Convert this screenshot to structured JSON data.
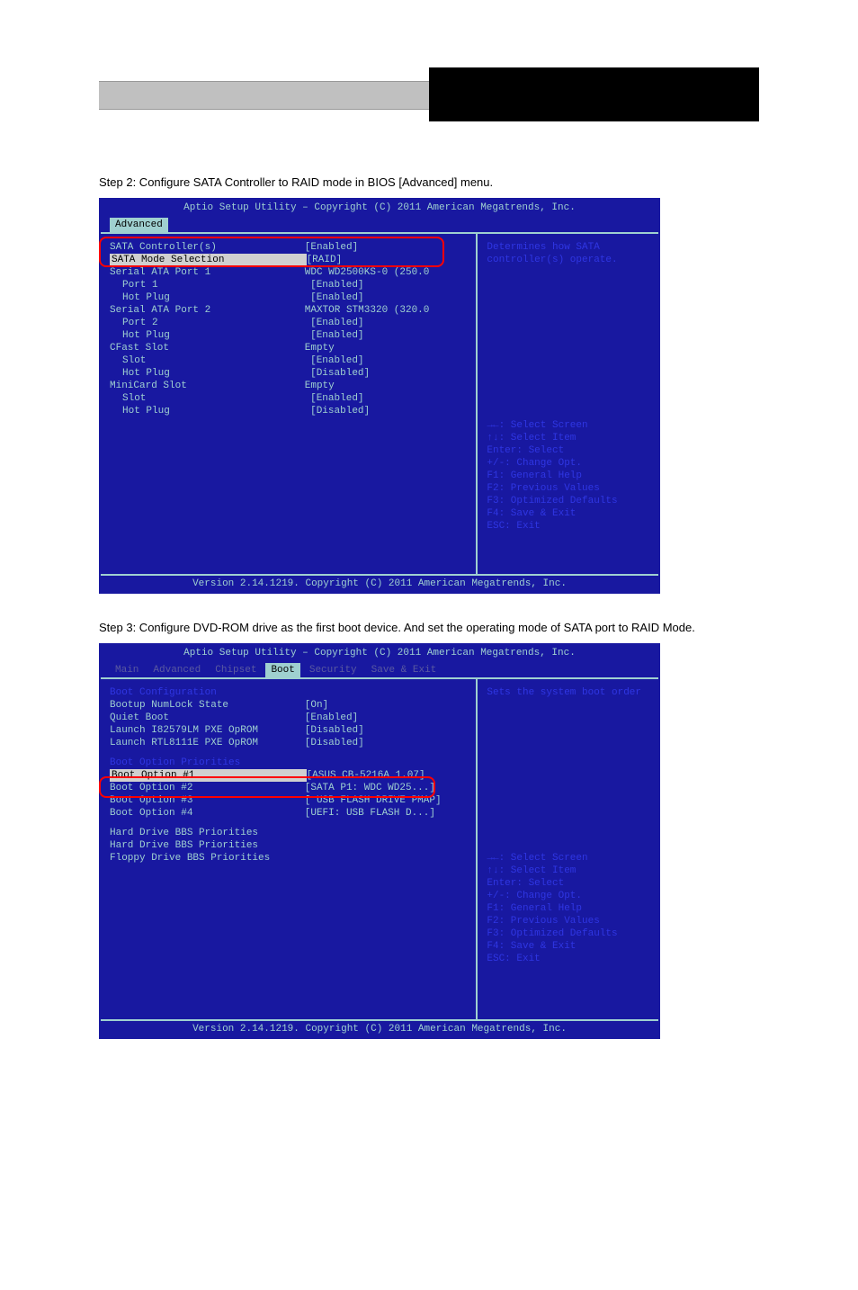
{
  "header_bios_title": "Aptio Setup Utility – Copyright (C) 2011 American Megatrends, Inc.",
  "footer_text": "Version 2.14.1219. Copyright (C) 2011 American Megatrends, Inc.",
  "step2_text": "Step 2: Configure SATA Controller to RAID mode in BIOS [Advanced] menu.",
  "step3_text": "Step 3: Configure DVD-ROM drive as the first boot device. And set the operating mode of SATA port to RAID Mode.",
  "screen1": {
    "tab_active": "Advanced",
    "items": [
      {
        "label": "SATA Controller(s)",
        "value": "[Enabled]"
      },
      {
        "label": "SATA Mode Selection",
        "value": "[RAID]",
        "selected": true
      },
      {
        "label": "",
        "value": ""
      },
      {
        "label": "Serial ATA Port 1",
        "value": "WDC WD2500KS-0 (250.0"
      },
      {
        "label": "Port 1",
        "value": "[Enabled]",
        "indent": true
      },
      {
        "label": "Hot Plug",
        "value": "[Enabled]",
        "indent": true
      },
      {
        "label": "Serial ATA Port 2",
        "value": "MAXTOR STM3320 (320.0"
      },
      {
        "label": "Port 2",
        "value": "[Enabled]",
        "indent": true
      },
      {
        "label": "Hot Plug",
        "value": "[Enabled]",
        "indent": true
      },
      {
        "label": "CFast Slot",
        "value": "Empty"
      },
      {
        "label": "Slot",
        "value": "[Enabled]",
        "indent": true
      },
      {
        "label": "Hot Plug",
        "value": "[Disabled]",
        "indent": true
      },
      {
        "label": "MiniCard Slot",
        "value": "Empty"
      },
      {
        "label": "Slot",
        "value": "[Enabled]",
        "indent": true
      },
      {
        "label": "Hot Plug",
        "value": "[Disabled]",
        "indent": true
      }
    ],
    "help": "Determines how SATA controller(s) operate."
  },
  "screen2": {
    "tabs": [
      "Main",
      "Advanced",
      "Chipset",
      "Boot",
      "Security",
      "Save & Exit"
    ],
    "tab_active": "Boot",
    "heading1": "Boot Configuration",
    "items_top": [
      {
        "label": "Bootup NumLock State",
        "value": "[On]"
      },
      {
        "label": "",
        "value": ""
      },
      {
        "label": "Quiet Boot",
        "value": "[Enabled]"
      },
      {
        "label": "Launch I82579LM PXE OpROM",
        "value": "[Disabled]"
      },
      {
        "label": "Launch RTL8111E PXE OpROM",
        "value": "[Disabled]"
      }
    ],
    "heading2": "Boot Option Priorities",
    "items_boot": [
      {
        "label": "Boot Option #1",
        "value": "[ASUS CB-5216A 1.07]",
        "selected": true
      },
      {
        "label": "Boot Option #2",
        "value": "[SATA  P1: WDC WD25...]"
      },
      {
        "label": "Boot Option #3",
        "value": "[ USB FLASH DRIVE PMAP]"
      },
      {
        "label": "Boot Option #4",
        "value": "[UEFI:  USB FLASH D...]"
      }
    ],
    "items_bottom": [
      {
        "label": "Hard Drive BBS Priorities",
        "value": ""
      },
      {
        "label": "Hard Drive BBS Priorities",
        "value": ""
      },
      {
        "label": "Floppy Drive BBS Priorities",
        "value": ""
      }
    ],
    "help": "Sets the system boot order"
  },
  "nav": {
    "l1": "→←: Select Screen",
    "l2": "↑↓: Select Item",
    "l3": "Enter: Select",
    "l4": "+/-: Change Opt.",
    "l5": "F1: General Help",
    "l6": "F2: Previous Values",
    "l7": "F3: Optimized Defaults",
    "l8": "F4: Save & Exit",
    "l9": "ESC: Exit"
  }
}
